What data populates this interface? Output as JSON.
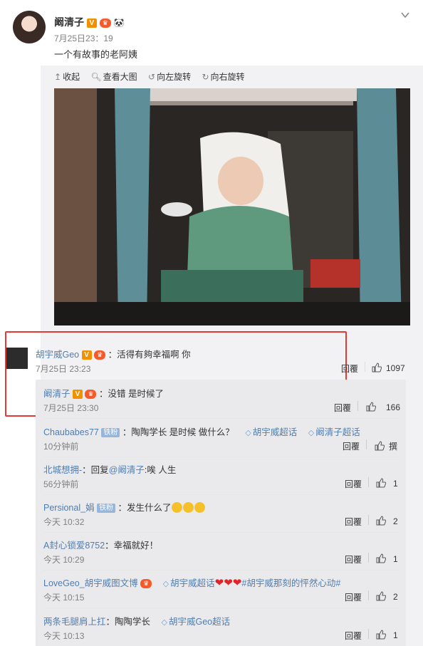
{
  "post": {
    "author": "阚清子",
    "time": "7月25日23：19",
    "text": "一个有故事的老阿姨"
  },
  "badges": {
    "v": "V",
    "crown": "♛"
  },
  "toolbar": {
    "collect": "收起",
    "view_large": "查看大图",
    "rotate_left": "向左旋转",
    "rotate_right": "向右旋转"
  },
  "comment": {
    "user": "胡宇威Geo",
    "text": "：活得有夠幸福啊 你",
    "time": "7月25日 23:23",
    "reply": "回覆",
    "likes": "1097"
  },
  "replies": [
    {
      "user": "阚清子",
      "text": "：没错 是时候了",
      "time": "7月25日 23:30",
      "reply": "回覆",
      "likes": "166"
    },
    {
      "user": "Chaubabes77",
      "badge": "铁粉",
      "text": "：陶陶学长 是时候 做什么？",
      "topics": [
        "胡宇威超话",
        "阚清子超话"
      ],
      "time": "10分钟前",
      "reply": "回覆",
      "likes": "撰"
    },
    {
      "user": "北城想拥-",
      "text": "：回复",
      "mention": "@阚清子",
      "text2": ":唉 人生",
      "time": "56分钟前",
      "reply": "回覆",
      "likes": "1"
    },
    {
      "user": "Persional_娟",
      "badge": "铁粉",
      "text": "：发生什么了",
      "time": "今天 10:32",
      "reply": "回覆",
      "likes": "2"
    },
    {
      "user": "A封心锁爱8752",
      "text": "：幸福就好！",
      "time": "今天 10:29",
      "reply": "回覆",
      "likes": "1"
    },
    {
      "user": "LoveGeo_胡宇威图文博",
      "topics": [
        "胡宇威超话"
      ],
      "tag": "#胡宇威那刻的怦然心动#",
      "time": "今天 10:15",
      "reply": "回覆",
      "likes": "2"
    },
    {
      "user": "两条毛腿肩上扛",
      "text": "：陶陶学长",
      "topics": [
        "胡宇威Geo超话"
      ],
      "time": "今天 10:13",
      "reply": "回覆",
      "likes": "1"
    }
  ],
  "colors": {
    "link": "#507daf",
    "highlight": "#e53936",
    "badge_orange": "#f29100"
  }
}
